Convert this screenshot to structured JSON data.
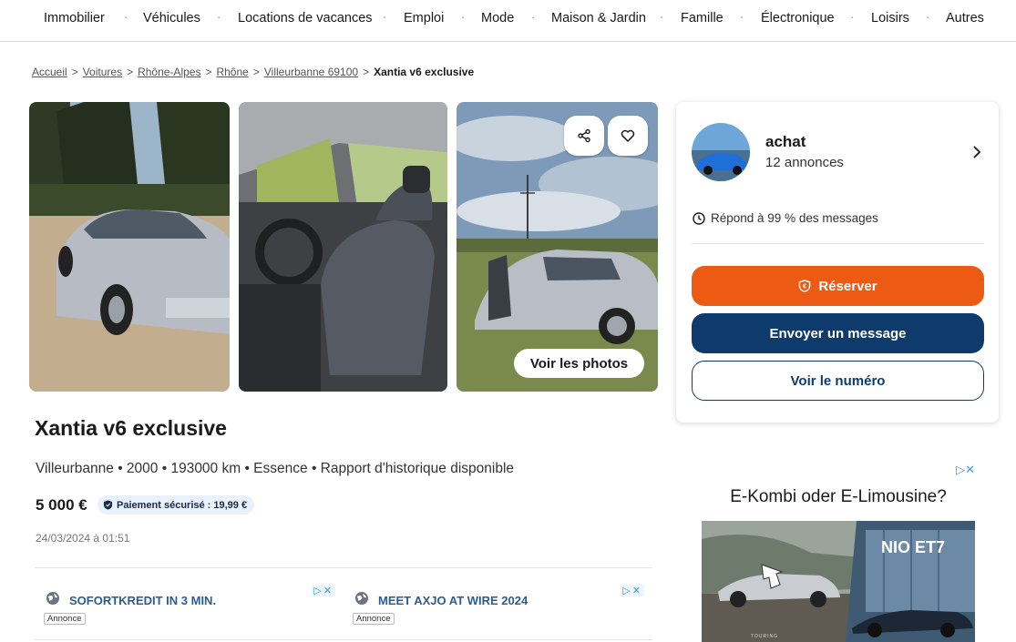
{
  "nav": {
    "items": [
      "Immobilier",
      "Véhicules",
      "Locations de vacances",
      "Emploi",
      "Mode",
      "Maison & Jardin",
      "Famille",
      "Électronique",
      "Loisirs",
      "Autres"
    ],
    "separator": "·"
  },
  "breadcrumb": {
    "items": [
      "Accueil",
      "Voitures",
      "Rhône-Alpes",
      "Rhône",
      "Villeurbanne 69100"
    ],
    "current": "Xantia v6 exclusive",
    "separator": ">"
  },
  "gallery": {
    "see_photos_label": "Voir les photos",
    "share_icon": "share-icon",
    "favorite_icon": "heart-icon"
  },
  "listing": {
    "title": "Xantia v6 exclusive",
    "details": "Villeurbanne • 2000 • 193000 km • Essence • Rapport d'historique disponible",
    "price": "5 000 €",
    "secure_payment": "Paiement sécurisé : 19,99 €",
    "date": "24/03/2024 à 01:51"
  },
  "seller": {
    "name": "achat",
    "ads_count": "12 annonces",
    "response": "Répond à 99 % des messages"
  },
  "actions": {
    "reserve": "Réserver",
    "message": "Envoyer un message",
    "number": "Voir le numéro"
  },
  "text_ads": [
    {
      "title": "SOFORTKREDIT IN 3 MIN.",
      "tag": "Annonce"
    },
    {
      "title": "MEET AXJO AT WIRE 2024",
      "tag": "Annonce"
    }
  ],
  "display_ad": {
    "headline": "E-Kombi oder E-Limousine?",
    "brand": "NIO ET7",
    "caption": "TOURING"
  },
  "colors": {
    "accent_orange": "#ec5a13",
    "navy": "#0e3b6b",
    "ad_link": "#2b5d92"
  }
}
